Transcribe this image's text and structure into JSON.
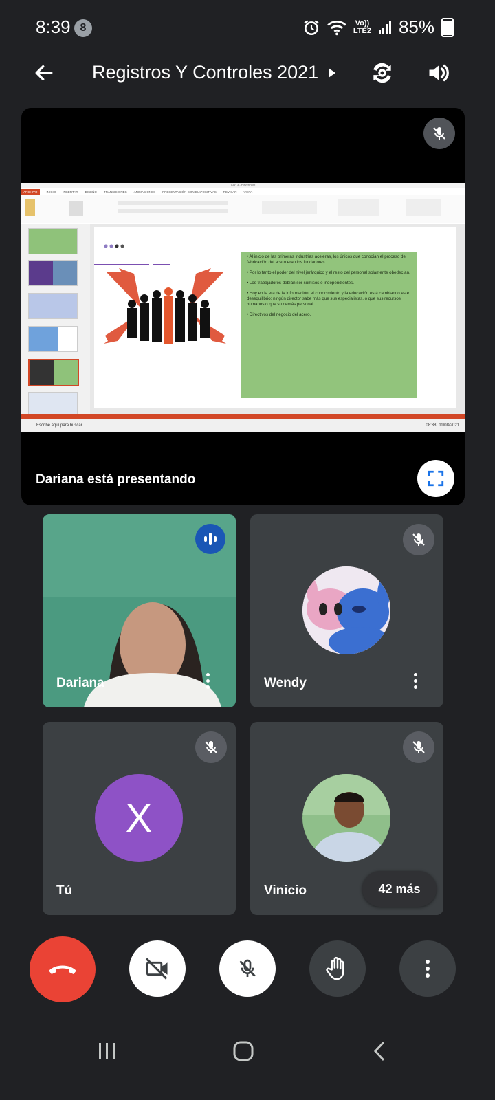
{
  "status_bar": {
    "time": "8:39",
    "notification_count": "8",
    "network_label_top": "Vo))",
    "network_label_bottom": "LTE2",
    "battery": "85%"
  },
  "header": {
    "title": "Registros Y Controles 2021"
  },
  "presentation": {
    "presenting_text": "Dariana está presentando",
    "screen": {
      "window_title": "CAP 3 - PowerPoint",
      "ribbon_tabs": [
        "ARCHIVO",
        "INICIO",
        "INSERTAR",
        "DISEÑO",
        "TRANSICIONES",
        "ANIMACIONES",
        "PRESENTACIÓN CON DIAPOSITIVAS",
        "REVISAR",
        "VISTA"
      ],
      "slide_bullets": [
        "Al inicio de las primeras industrias aceleras, los únicos que conocían el proceso de fabricación del acero eran los fundadores.",
        "Por lo tanto el poder del nivel jerárquico y el resto del personal solamente obedecían.",
        "Los trabajadores debían ser sumisos e independientes.",
        "Hoy en la era de la información, el conocimiento y la educación está cambiando este desequilibrio; ningún director sabe más que sus especialistas, o que sus recursos humanos o que su demás personal.",
        "Directivos del negocio del acero."
      ],
      "taskbar_search": "Escribe aquí para buscar",
      "taskbar_time": "08:38",
      "taskbar_date": "11/08/2021"
    }
  },
  "participants": [
    {
      "name": "Dariana",
      "speaking": true
    },
    {
      "name": "Wendy",
      "muted": true
    },
    {
      "name": "Tú",
      "avatar_letter": "X",
      "muted": true
    },
    {
      "name": "Vinicio",
      "muted": true
    }
  ],
  "more_participants": "42 más",
  "controls": [
    "end-call",
    "camera-off",
    "mic-off",
    "raise-hand",
    "more-options"
  ],
  "colors": {
    "background": "#202124",
    "tile": "#3c4043",
    "end_call": "#ea4335",
    "avatar_purple": "#8e52c6",
    "speaking_blue": "#1a56b5"
  }
}
